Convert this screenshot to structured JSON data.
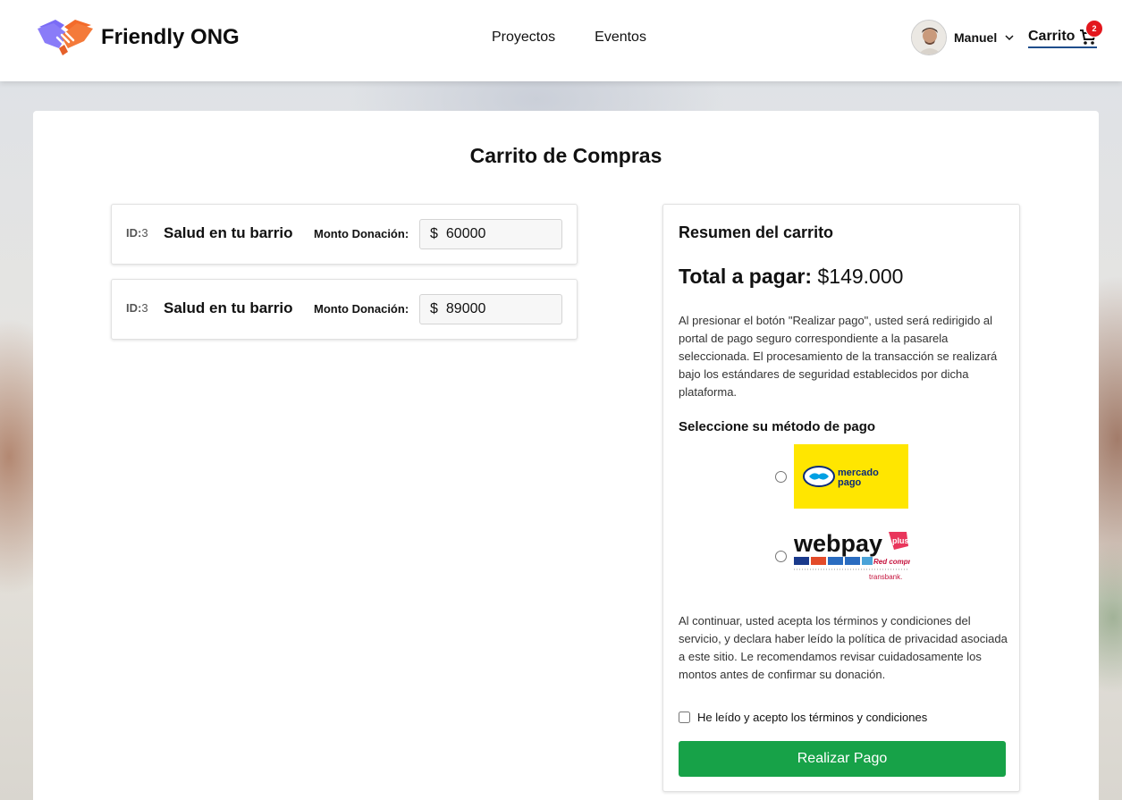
{
  "header": {
    "brand_name": "Friendly ONG",
    "nav": [
      {
        "label": "Proyectos"
      },
      {
        "label": "Eventos"
      }
    ],
    "user_name": "Manuel",
    "cart_label": "Carrito",
    "cart_count": "2"
  },
  "page": {
    "title": "Carrito de Compras"
  },
  "cart_items": [
    {
      "id_label": "ID:",
      "id": "3",
      "title": "Salud en tu barrio",
      "amount_label": "Monto Donación:",
      "currency": "$",
      "amount": "60000"
    },
    {
      "id_label": "ID:",
      "id": "3",
      "title": "Salud en tu barrio",
      "amount_label": "Monto Donación:",
      "currency": "$",
      "amount": "89000"
    }
  ],
  "summary": {
    "title": "Resumen del carrito",
    "total_label": "Total a pagar:",
    "total_value": "$149.000",
    "info_text": "Al presionar el botón \"Realizar pago\", usted será redirigido al portal de pago seguro correspondiente a la pasarela seleccionada. El procesamiento de la transacción se realizará bajo los estándares de seguridad establecidos por dicha plataforma.",
    "method_label": "Seleccione su método de pago",
    "methods": [
      {
        "name": "mercado pago",
        "line1": "mercado",
        "line2": "pago"
      },
      {
        "name": "webpay plus",
        "word": "webpay",
        "plus": "plus",
        "sub": "transbank.",
        "cards": "Red compra"
      }
    ],
    "terms_text": "Al continuar, usted acepta los términos y condiciones del servicio, y declara haber leído la política de privacidad asociada a este sitio. Le recomendamos revisar cuidadosamente los montos antes de confirmar su donación.",
    "accept_label": "He leído y acepto los términos y condiciones",
    "pay_button": "Realizar Pago"
  },
  "colors": {
    "pay_button": "#17a248",
    "cart_badge": "#e3171d",
    "mercado_pago_bg": "#ffe600",
    "logo_purple": "#7b6cf6",
    "logo_orange": "#f36b2b"
  }
}
